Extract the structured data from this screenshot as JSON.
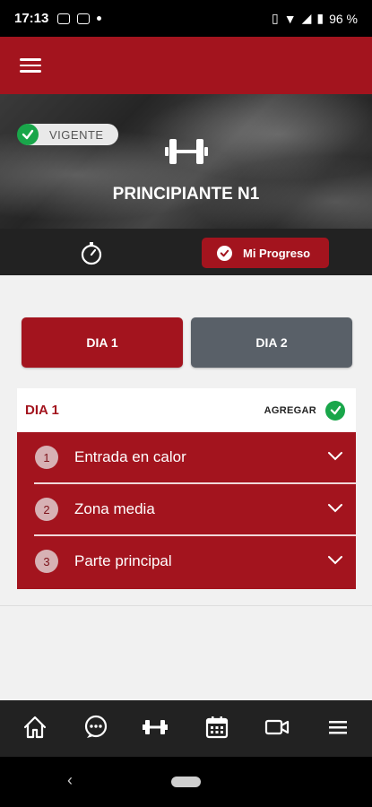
{
  "status_bar": {
    "time": "17:13",
    "battery": "96 %"
  },
  "hero": {
    "status_badge": "VIGENTE",
    "title": "PRINCIPIANTE N1"
  },
  "sub_bar": {
    "progress_button": "Mi Progreso"
  },
  "day_tabs": [
    {
      "label": "DIA 1",
      "active": true
    },
    {
      "label": "DIA 2",
      "active": false
    }
  ],
  "day_card": {
    "title": "DIA 1",
    "add_label": "AGREGAR",
    "sections": [
      {
        "number": "1",
        "label": "Entrada en calor"
      },
      {
        "number": "2",
        "label": "Zona media"
      },
      {
        "number": "3",
        "label": "Parte principal"
      }
    ]
  },
  "bottom_nav": [
    "home-icon",
    "chat-icon",
    "dumbbell-icon",
    "calendar-icon",
    "video-icon",
    "menu-icon"
  ],
  "colors": {
    "brand": "#a3141e",
    "inactive_tab": "#596068",
    "success": "#19a64a"
  }
}
